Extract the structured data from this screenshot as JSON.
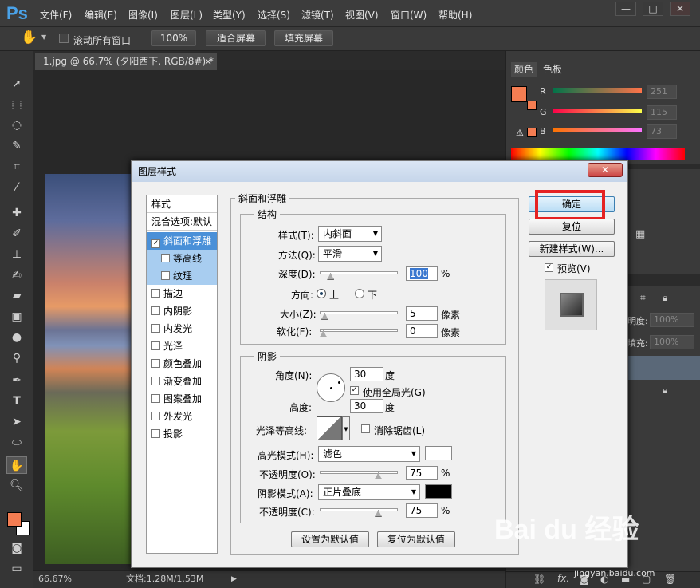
{
  "app": {
    "logo": "Ps"
  },
  "menu": [
    "文件(F)",
    "编辑(E)",
    "图像(I)",
    "图层(L)",
    "类型(Y)",
    "选择(S)",
    "滤镜(T)",
    "视图(V)",
    "窗口(W)",
    "帮助(H)"
  ],
  "window_controls": {
    "minimize": "—",
    "maximize": "□",
    "close": "✕"
  },
  "options_bar": {
    "scroll_all_label": "滚动所有窗口",
    "zoom_100": "100%",
    "fit_screen": "适合屏幕",
    "fill_screen": "填充屏幕"
  },
  "document_tab": {
    "title": "1.jpg @ 66.7% (夕阳西下, RGB/8#) *",
    "close": "×"
  },
  "status": {
    "zoom": "66.67%",
    "doc_info": "文档:1.28M/1.53M"
  },
  "color_panel": {
    "tabs": [
      "颜色",
      "色板"
    ],
    "foreground_color": "#f47d52",
    "channels": [
      {
        "label": "R",
        "value": "251"
      },
      {
        "label": "G",
        "value": "115"
      },
      {
        "label": "B",
        "value": "73"
      }
    ]
  },
  "layers_panel": {
    "opacity_label": "明度:",
    "opacity_value": "100%",
    "fill_label": "填充:",
    "fill_value": "100%"
  },
  "dialog": {
    "title": "图层样式",
    "close": "✕",
    "styles_header": "样式",
    "blend_options": "混合选项:默认",
    "style_items": [
      {
        "label": "斜面和浮雕",
        "checked": true,
        "state": "selected"
      },
      {
        "label": "等高线",
        "checked": false,
        "state": "sub"
      },
      {
        "label": "纹理",
        "checked": false,
        "state": "sub"
      },
      {
        "label": "描边",
        "checked": false,
        "state": "normal"
      },
      {
        "label": "内阴影",
        "checked": false,
        "state": "normal"
      },
      {
        "label": "内发光",
        "checked": false,
        "state": "normal"
      },
      {
        "label": "光泽",
        "checked": false,
        "state": "normal"
      },
      {
        "label": "颜色叠加",
        "checked": false,
        "state": "normal"
      },
      {
        "label": "渐变叠加",
        "checked": false,
        "state": "normal"
      },
      {
        "label": "图案叠加",
        "checked": false,
        "state": "normal"
      },
      {
        "label": "外发光",
        "checked": false,
        "state": "normal"
      },
      {
        "label": "投影",
        "checked": false,
        "state": "normal"
      }
    ],
    "bevel": {
      "section_title": "斜面和浮雕",
      "structure_title": "结构",
      "style_label": "样式(T):",
      "style_value": "内斜面",
      "technique_label": "方法(Q):",
      "technique_value": "平滑",
      "depth_label": "深度(D):",
      "depth_value": "100",
      "depth_unit": "%",
      "depth_fraction": 0.1,
      "direction_label": "方向:",
      "direction_up": "上",
      "direction_down": "下",
      "direction_selected": "up",
      "size_label": "大小(Z):",
      "size_value": "5",
      "size_unit": "像素",
      "size_fraction": 0.02,
      "soften_label": "软化(F):",
      "soften_value": "0",
      "soften_unit": "像素",
      "soften_fraction": 0.0
    },
    "shading": {
      "title": "阴影",
      "angle_label": "角度(N):",
      "angle_value": "30",
      "angle_unit": "度",
      "global_light_label": "使用全局光(G)",
      "global_light_checked": true,
      "altitude_label": "高度:",
      "altitude_value": "30",
      "altitude_unit": "度",
      "gloss_contour_label": "光泽等高线:",
      "anti_alias_label": "消除锯齿(L)",
      "anti_alias_checked": false,
      "highlight_mode_label": "高光模式(H):",
      "highlight_mode_value": "滤色",
      "highlight_color": "#ffffff",
      "highlight_opacity_label": "不透明度(O):",
      "highlight_opacity_value": "75",
      "highlight_opacity_unit": "%",
      "highlight_opacity_fraction": 0.75,
      "shadow_mode_label": "阴影模式(A):",
      "shadow_mode_value": "正片叠底",
      "shadow_color": "#000000",
      "shadow_opacity_label": "不透明度(C):",
      "shadow_opacity_value": "75",
      "shadow_opacity_unit": "%",
      "shadow_opacity_fraction": 0.75
    },
    "make_default": "设置为默认值",
    "reset_default": "复位为默认值",
    "ok": "确定",
    "reset": "复位",
    "new_style": "新建样式(W)...",
    "preview_label": "预览(V)",
    "preview_checked": true
  },
  "watermark": {
    "brand": "Bai du 经验",
    "url": "jingyan.baidu.com"
  },
  "colors": {
    "highlight_box": "#e52222",
    "selected_item": "#4a90d8"
  }
}
